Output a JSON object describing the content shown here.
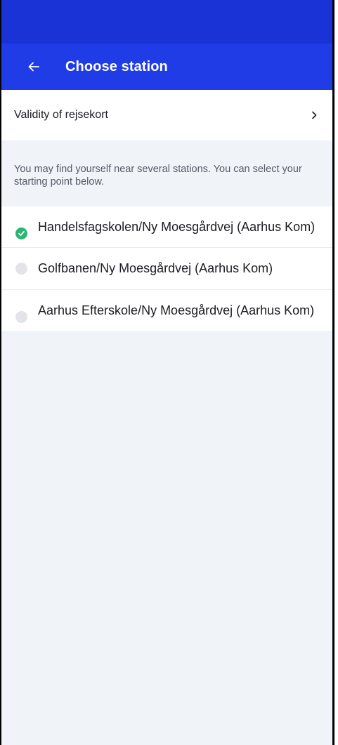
{
  "header": {
    "title": "Choose station"
  },
  "validity": {
    "label": "Validity of rejsekort"
  },
  "info": {
    "text": "You may find yourself near several stations. You can select your starting point below."
  },
  "stations": [
    {
      "name": "Handelsfagskolen/Ny Moesgårdvej (Aarhus Kom)",
      "selected": true
    },
    {
      "name": "Golfbanen/Ny Moesgårdvej (Aarhus Kom)",
      "selected": false
    },
    {
      "name": "Aarhus Efterskole/Ny Moesgårdvej (Aarhus Kom)",
      "selected": false
    }
  ],
  "colors": {
    "app_bar": "#1f3ce6",
    "status_bar": "#1a33d6",
    "selected": "#2bb673",
    "background": "#f0f3f8"
  }
}
